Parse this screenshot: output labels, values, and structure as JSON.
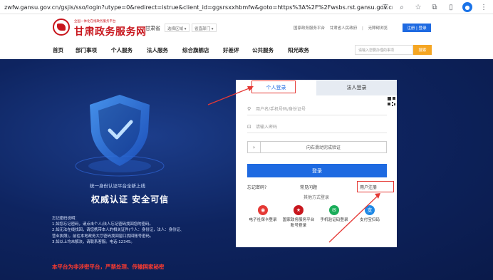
{
  "browser": {
    "url": "zwfw.gansu.gov.cn/gsjis/sso/login?utype=0&redirect=istrue&client_id=ggsrsxxhbmfw&goto=https%3A%2F%2Fwsbs.rst.gansu.gov.cn%2Fpublics...",
    "icons": [
      "key-icon",
      "zoom-icon",
      "star-icon",
      "extensions-icon",
      "sidebar-icon",
      "profile-icon",
      "menu-icon"
    ]
  },
  "site": {
    "logo_subtitle": "全国一体化在线政务服务平台",
    "logo_title": "甘肃政务服务网",
    "province": "甘肃省",
    "select_region": "选择区域 ▾",
    "select_dept": "省直部门 ▾",
    "header_links": [
      "国家政务服务平台",
      "甘肃省人民政府",
      "无障碍浏览"
    ],
    "login_register": "注册 | 登录"
  },
  "nav": {
    "items": [
      "首页",
      "部门事项",
      "个人服务",
      "法人服务",
      "综合旗舰店",
      "好差评",
      "公共服务",
      "阳光政务"
    ],
    "search_placeholder": "请输入您要办理的事项",
    "search_button": "搜索"
  },
  "hero": {
    "tagline": "统一身份认证平台全新上线",
    "slogan": "权威认证  安全可信",
    "notes": [
      "忘记密码说明：",
      "1.如您忘记密码，请点击个人/法人忘记密码找回您的密码。",
      "2.如无法在线找回，请您携带本人的相关证件(个人：身份证，法人：身份证、",
      "营业执照)，前往本地政务大厅密码找回窗口找回账号密码。",
      "3.如以上均未解决，请联系客服。电话:12345。"
    ],
    "warning": "本平台为非涉密平台，严禁处理、传输国家秘密"
  },
  "login": {
    "tab_personal": "个人登录",
    "tab_corporate": "法人登录",
    "username_placeholder": "用户名/手机号码/身份证号",
    "password_placeholder": "请输入密码",
    "slider_text": "向右滑动完成验证",
    "submit": "登录",
    "forgot": "忘记密码?",
    "faq": "常见问题",
    "register": "用户注册",
    "other_methods": "其他方式登录",
    "options": [
      {
        "label": "电子社保卡登录",
        "color": "#e53935",
        "icon": "social-card-icon"
      },
      {
        "label": "国家政务服务平台账号登录",
        "color": "#c8161d",
        "icon": "national-emblem-icon"
      },
      {
        "label": "手机验证码登录",
        "color": "#1aad5a",
        "icon": "phone-sms-icon"
      },
      {
        "label": "支付宝扫码",
        "color": "#1e88e5",
        "icon": "alipay-icon"
      }
    ]
  }
}
